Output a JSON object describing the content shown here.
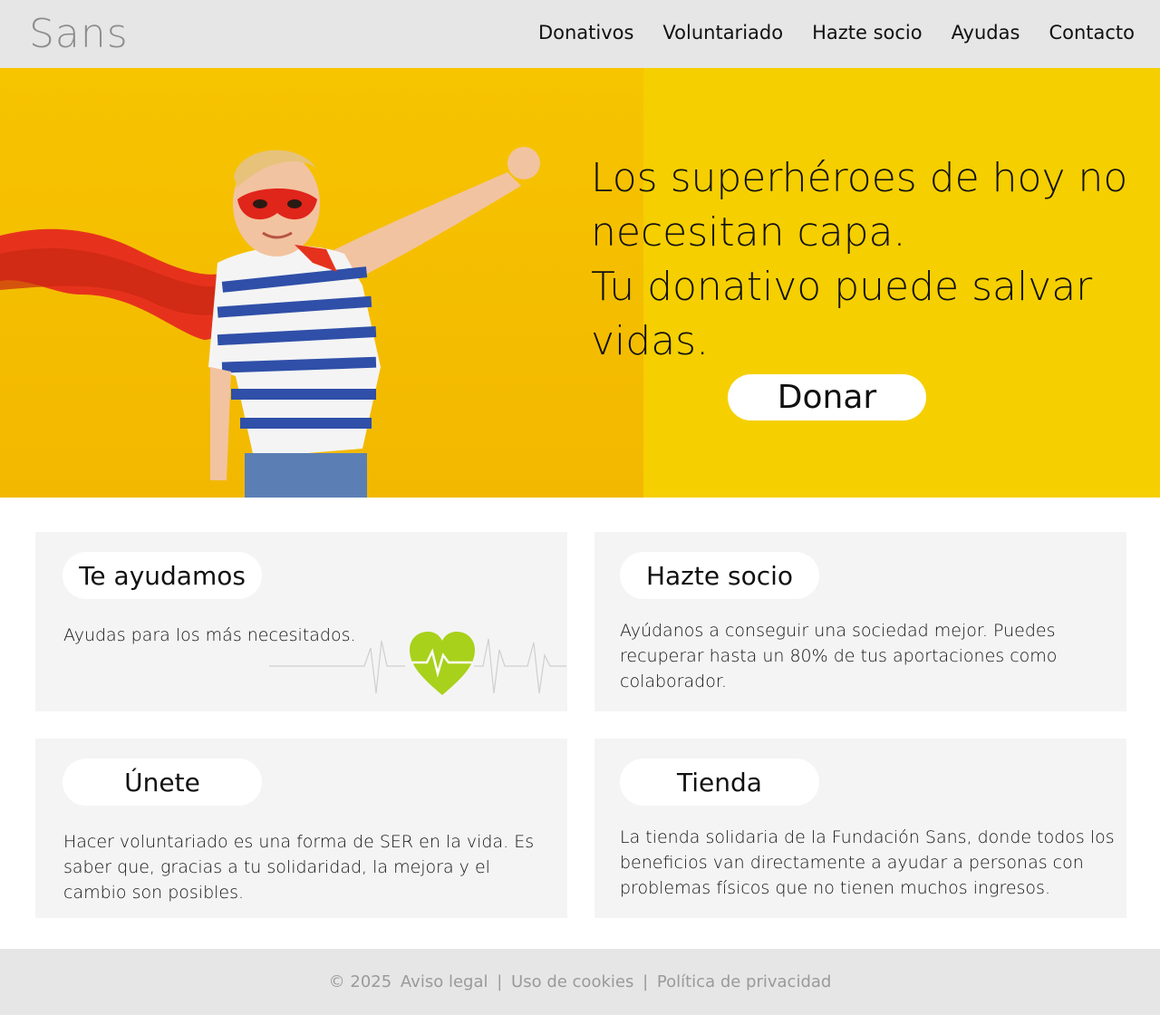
{
  "header": {
    "logo": "Sans",
    "nav": [
      "Donativos",
      "Voluntariado",
      "Hazte socio",
      "Ayudas",
      "Contacto"
    ]
  },
  "hero": {
    "lines": [
      "Los superhéroes de hoy no",
      "necesitan capa.",
      "Tu donativo puede salvar",
      "vidas."
    ],
    "button": "Donar"
  },
  "cards": [
    {
      "title": "Te ayudamos",
      "text": "Ayudas para los más necesitados."
    },
    {
      "title": "Hazte socio",
      "text": "Ayúdanos a conseguir una sociedad mejor. Puedes recuperar hasta un 80% de tus aportaciones como colaborador."
    },
    {
      "title": "Únete",
      "text": "Hacer voluntariado es una forma de SER en la vida. Es saber que, gracias a tu solidaridad, la mejora y el cambio son posibles."
    },
    {
      "title": "Tienda",
      "text": "La tienda solidaria de la Fundación Sans, donde todos los beneficios van directamente a ayudar a personas con problemas físicos que no tienen muchos ingresos."
    }
  ],
  "footer": {
    "copyright": "© 2025",
    "links": [
      "Aviso legal",
      "Uso de cookies",
      "Política de privacidad"
    ]
  },
  "colors": {
    "hero_bg": "#f5cf00",
    "heart": "#a8d11b"
  },
  "icons": [
    "heart-pulse-icon"
  ]
}
